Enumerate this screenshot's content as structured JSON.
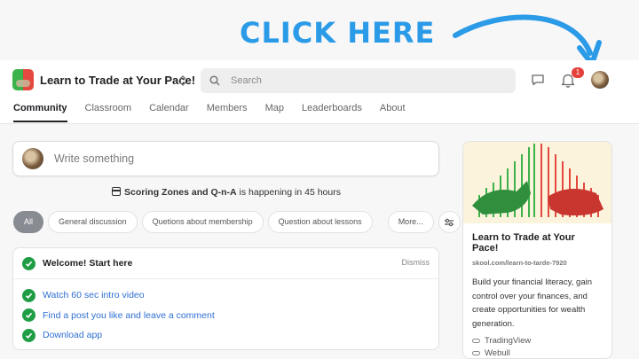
{
  "annotation": {
    "text": "CLICK HERE"
  },
  "brand": {
    "name": "Learn to Trade at Your Pace!"
  },
  "search": {
    "placeholder": "Search"
  },
  "notifications": {
    "count": "1"
  },
  "tabs": [
    {
      "label": "Community",
      "active": true
    },
    {
      "label": "Classroom"
    },
    {
      "label": "Calendar"
    },
    {
      "label": "Members"
    },
    {
      "label": "Map"
    },
    {
      "label": "Leaderboards"
    },
    {
      "label": "About"
    }
  ],
  "composer": {
    "placeholder": "Write something"
  },
  "event": {
    "name": "Scoring Zones and Q-n-A",
    "suffix": " is happening in 45 hours"
  },
  "chips": {
    "all": "All",
    "general": "General discussion",
    "membership": "Quetions about membership",
    "lessons": "Question about lessons",
    "more": "More..."
  },
  "welcome": {
    "title": "Welcome! Start here",
    "dismiss": "Dismiss",
    "tasks": [
      "Watch 60 sec intro video",
      "Find a post you like and leave a comment",
      "Download app"
    ]
  },
  "about": {
    "title": "Learn to Trade at Your Pace!",
    "url": "skool.com/learn-to-tarde-7920",
    "description": "Build your financial literacy, gain control over your finances, and create opportunities for wealth generation.",
    "links": [
      "TradingView",
      "Webull"
    ]
  },
  "colors": {
    "accent": "#2b9be8",
    "check": "#1f9d45",
    "link": "#2f6fd1",
    "badge": "#e5413c"
  }
}
